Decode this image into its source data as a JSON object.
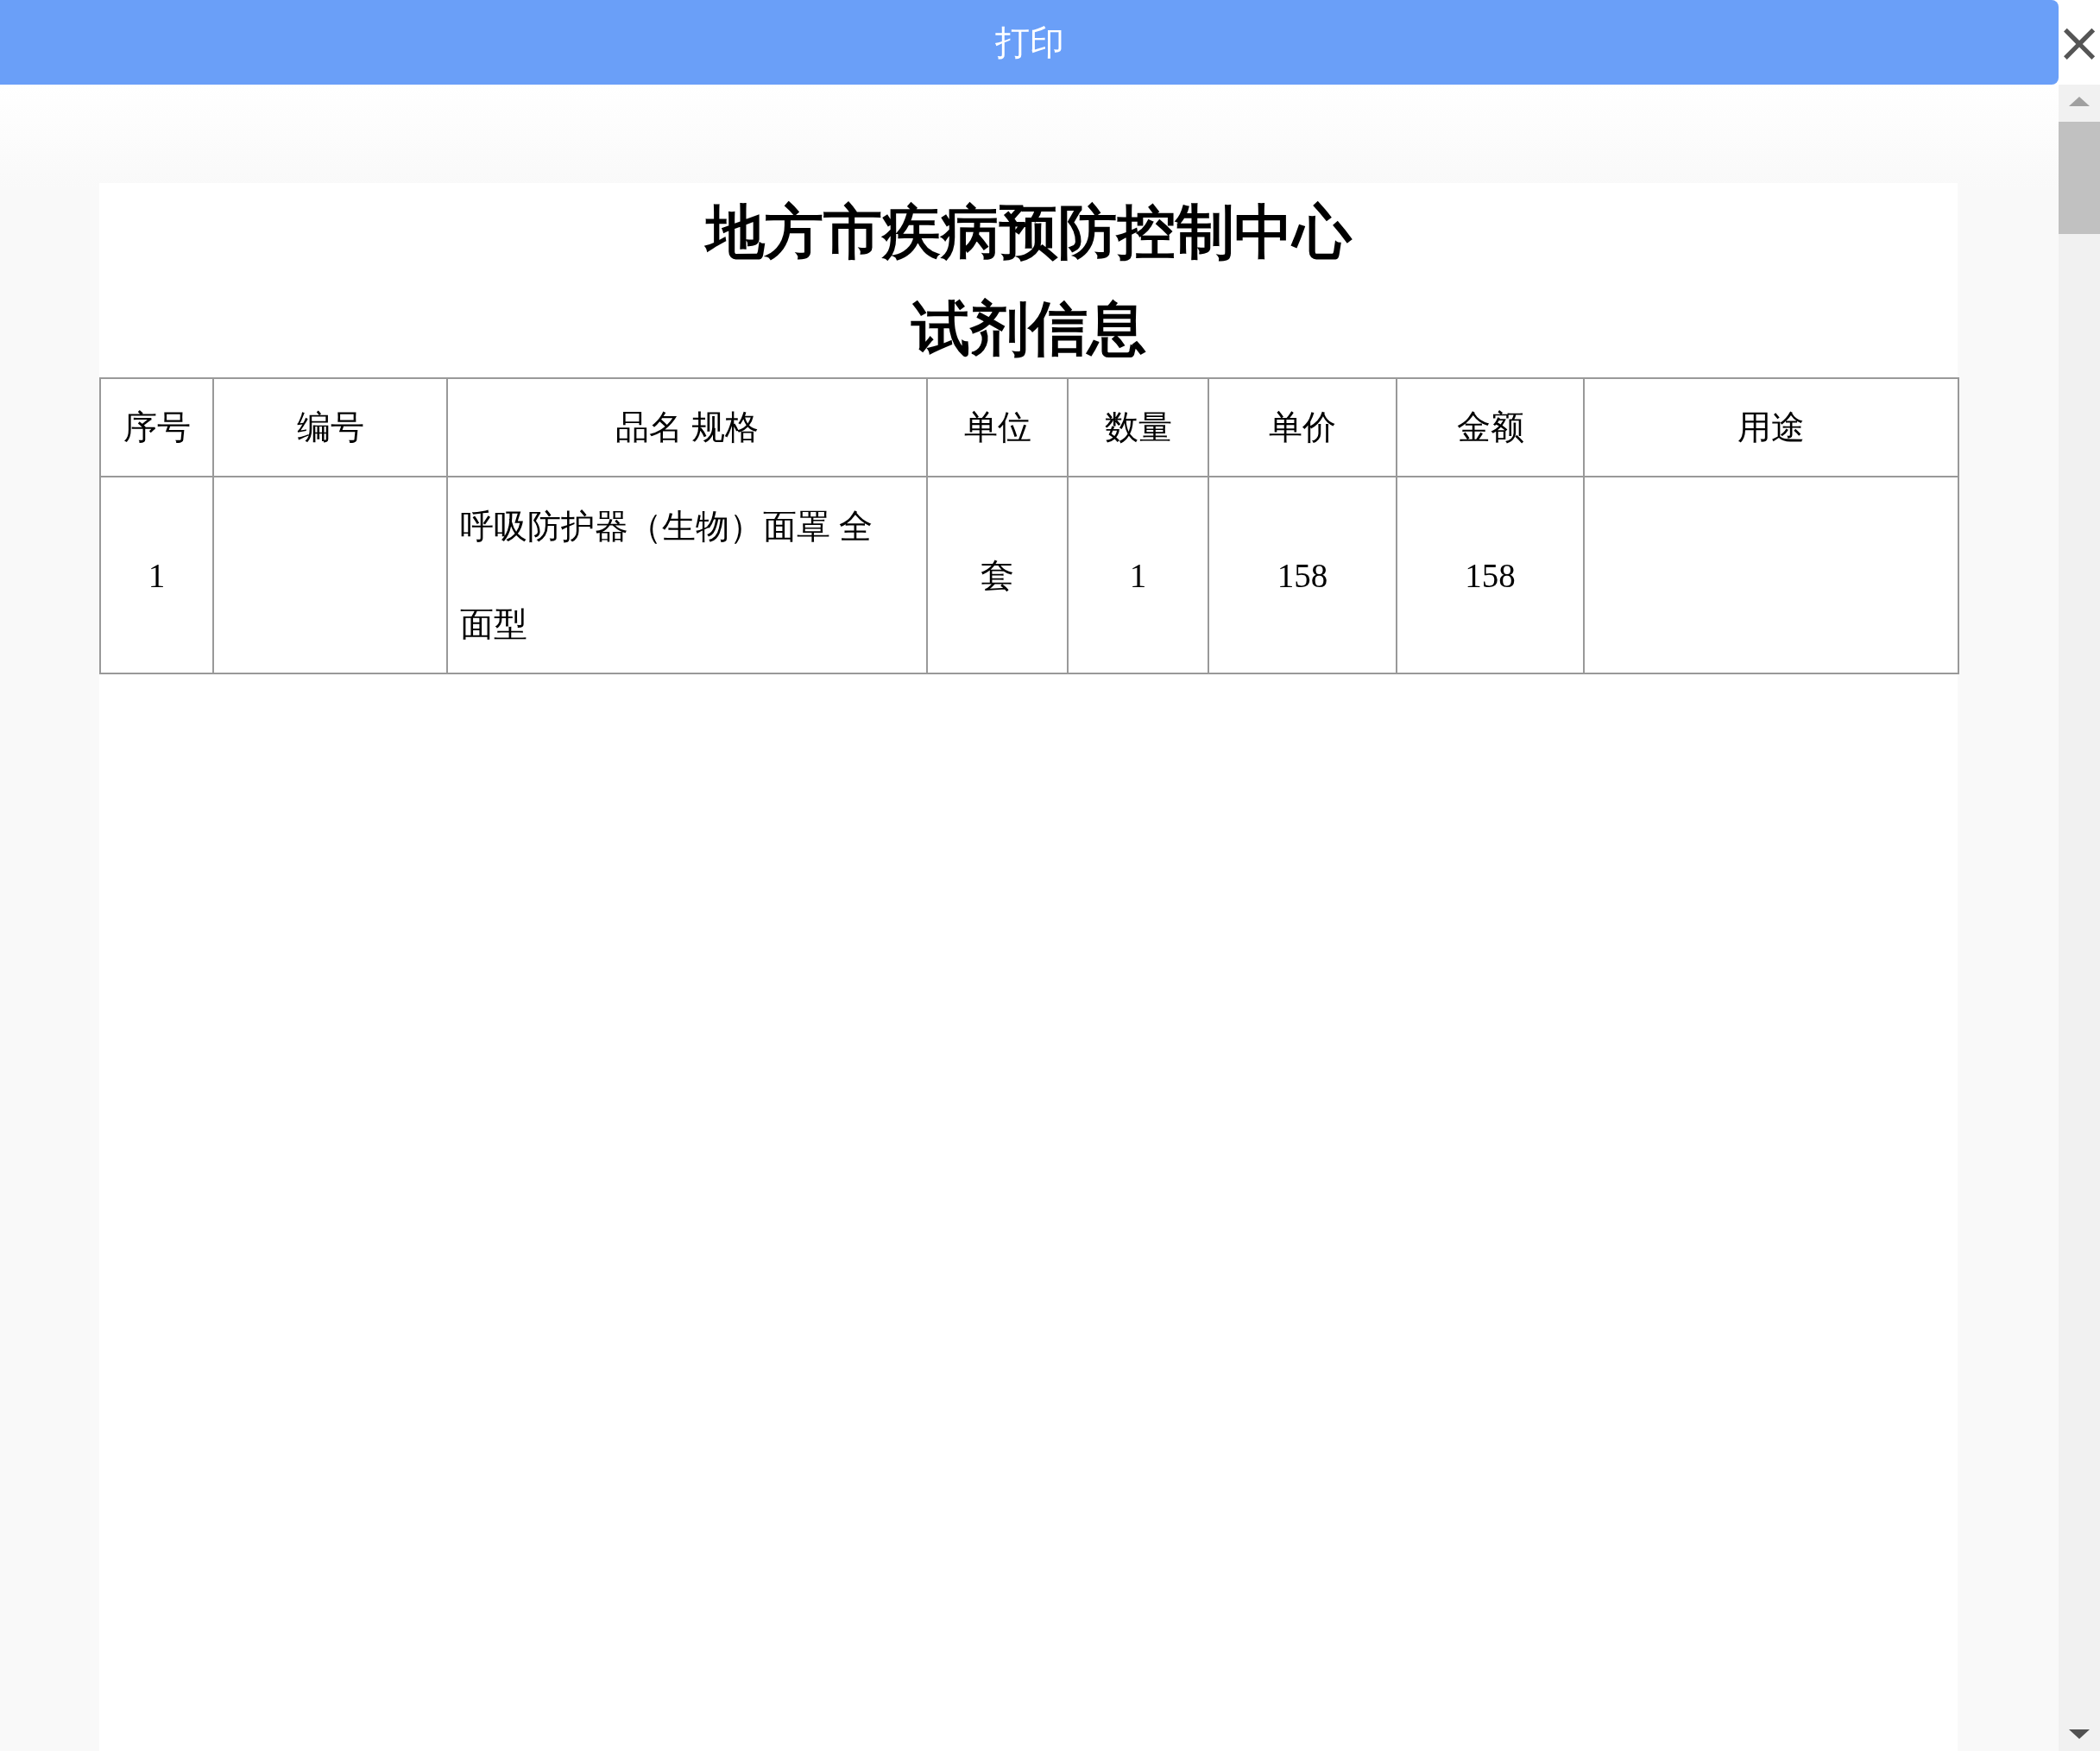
{
  "dialog": {
    "title": "打印",
    "close_icon": "×"
  },
  "document": {
    "organization": "地方市疾病预防控制中心",
    "title": "试剂信息",
    "table": {
      "columns": [
        "序号",
        "编号",
        "品名 规格",
        "单位",
        "数量",
        "单价",
        "金额",
        "用途"
      ],
      "rows": [
        {
          "index": "1",
          "name_spec": "呼吸防护器（生物）面罩 全面型",
          "unit": "套",
          "quantity": "1",
          "unit_price": "158",
          "amount": "158"
        }
      ]
    }
  }
}
